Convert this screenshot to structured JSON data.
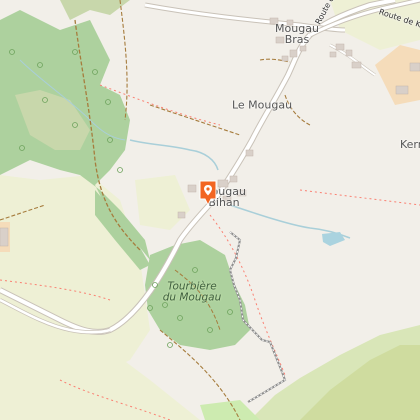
{
  "map": {
    "colors": {
      "land": "#f2efe9",
      "forest": "#add19e",
      "meadow": "#cdebb0",
      "scrub": "#c8d7ab",
      "farmland": "#eef0d5",
      "farmyard": "#f5dcba",
      "road": "#ffffff",
      "road_casing": "#c9c2b8",
      "track": "#a67c3d",
      "path": "#fa8072",
      "building": "#d9d0c9",
      "water": "#aad3df",
      "stream": "#a9cfd9",
      "marker": "#f26522"
    },
    "labels": {
      "mougau_bras": "Mougau\nBras",
      "le_mougau": "Le Mougau",
      "mougau_bihan": "Mougau\nBihan",
      "tourbiere": "Tourbière\ndu Mougau",
      "kern": "Kern",
      "route_1": "Route de K",
      "route_2": "Route d"
    },
    "marker_icon": "location-pin-icon"
  }
}
